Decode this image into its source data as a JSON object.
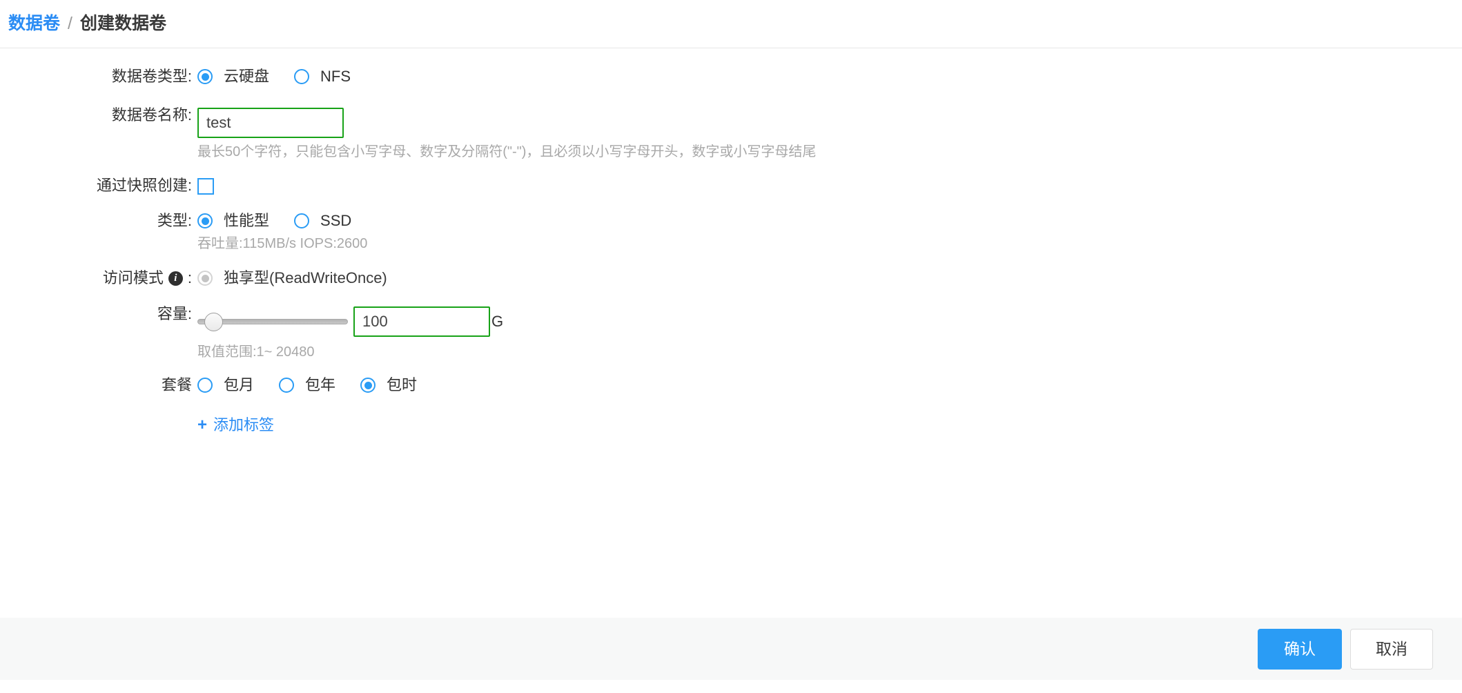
{
  "breadcrumb": {
    "parent": "数据卷",
    "separator": "/",
    "current": "创建数据卷"
  },
  "form": {
    "volume_type": {
      "label": "数据卷类型:",
      "options": [
        {
          "label": "云硬盘",
          "selected": true
        },
        {
          "label": "NFS",
          "selected": false
        }
      ]
    },
    "volume_name": {
      "label": "数据卷名称:",
      "value": "test",
      "placeholder": "",
      "hint": "最长50个字符，只能包含小写字母、数字及分隔符(\"-\")，且必须以小写字母开头，数字或小写字母结尾"
    },
    "create_from_snapshot": {
      "label": "通过快照创建:",
      "checked": false
    },
    "disk_type": {
      "label": "类型:",
      "options": [
        {
          "label": "性能型",
          "selected": true
        },
        {
          "label": "SSD",
          "selected": false
        }
      ],
      "hint": "吞吐量:115MB/s IOPS:2600"
    },
    "access_mode": {
      "label": "访问模式",
      "label_suffix": ":",
      "info_icon": "info-icon",
      "options": [
        {
          "label": "独享型(ReadWriteOnce)",
          "selected": true,
          "disabled": true
        }
      ]
    },
    "capacity": {
      "label": "容量:",
      "value": "100",
      "unit": "G",
      "slider_percent": 10,
      "hint": "取值范围:1~ 20480"
    },
    "package": {
      "label": "套餐",
      "options": [
        {
          "label": "包月",
          "selected": false
        },
        {
          "label": "包年",
          "selected": false
        },
        {
          "label": "包时",
          "selected": true
        }
      ]
    },
    "add_tag": {
      "icon": "plus-icon",
      "plus": "+",
      "label": "添加标签"
    }
  },
  "footer": {
    "confirm_label": "确认",
    "cancel_label": "取消"
  },
  "colors": {
    "accent_blue": "#2a9cf5",
    "link_blue": "#2a8cf4",
    "input_border_green": "#17a217",
    "hint_gray": "#a8a8a8",
    "footer_bg": "#f7f8f8"
  }
}
